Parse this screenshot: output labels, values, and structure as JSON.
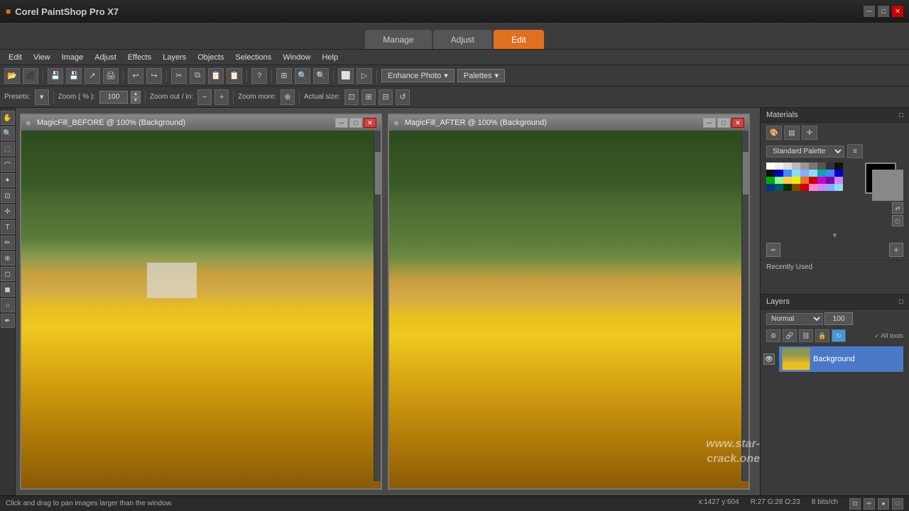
{
  "titlebar": {
    "title": "Corel PaintShop Pro X7",
    "controls": [
      "minimize",
      "maximize",
      "close"
    ]
  },
  "menubar": {
    "items": [
      "Edit",
      "View",
      "Image",
      "Adjust",
      "Effects",
      "Layers",
      "Objects",
      "Selections",
      "Window",
      "Help"
    ]
  },
  "modetabs": {
    "tabs": [
      "Manage",
      "Adjust",
      "Edit"
    ],
    "active": "Edit"
  },
  "toolbar": {
    "enhance_photo": "Enhance Photo",
    "palettes": "Palettes"
  },
  "toolbar2": {
    "presets_label": "Presets:",
    "zoom_label": "Zoom ( % ):",
    "zoom_value": "100",
    "zoom_out_label": "Zoom out / in:",
    "zoom_more_label": "Zoom more:",
    "actual_size_label": "Actual size:"
  },
  "windows": {
    "before": {
      "title": "MagicFill_BEFORE @ 100% (Background)"
    },
    "after": {
      "title": "MagicFill_AFTER @ 100% (Background)"
    }
  },
  "rightpanel": {
    "materials": {
      "title": "Materials",
      "palette_label": "Standard Palette"
    },
    "recently_used": {
      "label": "Recently Used"
    },
    "layers": {
      "title": "Layers",
      "blend_mode": "Normal",
      "opacity": "100",
      "layer_name": "Background",
      "all_tools": "All tools"
    }
  },
  "statusbar": {
    "message": "Click and drag to pan images larger than the window.",
    "coords": "x:1427 y:604",
    "info": "R:27 G:28 O:23",
    "bits": "8 bits/ch"
  },
  "watermark": {
    "line1": "www.star-",
    "line2": "crack.one"
  }
}
